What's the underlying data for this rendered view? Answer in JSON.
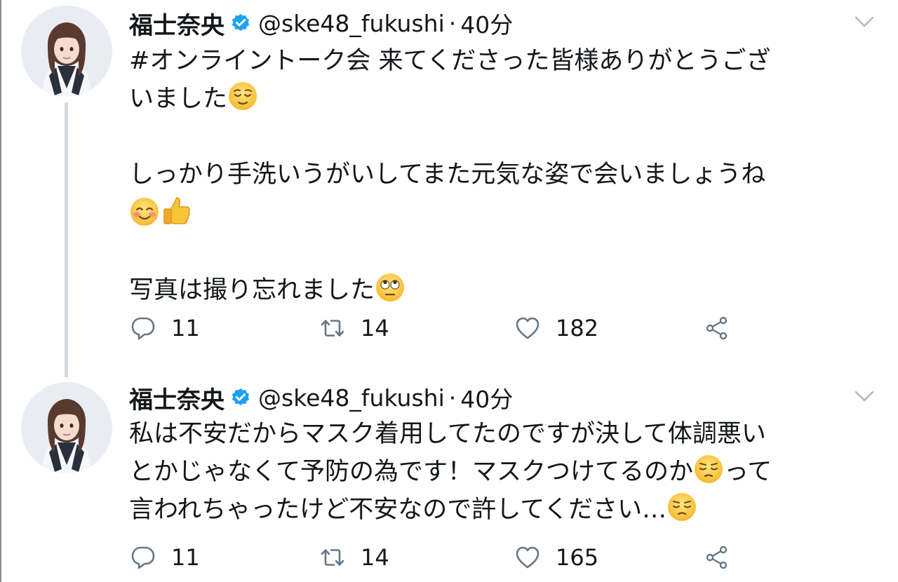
{
  "tweets": [
    {
      "author": {
        "name": "福士奈央",
        "handle": "@ske48_fukushi",
        "verified": true
      },
      "separator": "·",
      "time": "40分",
      "body_lines": [
        "#オンライントーク会 来てくださった皆様ありがとうござ",
        "いました",
        "",
        "しっかり手洗いうがいしてまた元気な姿で会いましょうね",
        "",
        "",
        "写真は撮り忘れました"
      ],
      "emojis": [
        "relieved-face",
        "smiling-face-blush",
        "thumbs-up",
        "face-rolling-eyes"
      ],
      "actions": {
        "replies": "11",
        "retweets": "14",
        "likes": "182"
      }
    },
    {
      "author": {
        "name": "福士奈央",
        "handle": "@ske48_fukushi",
        "verified": true
      },
      "separator": "·",
      "time": "40分",
      "body_lines": [
        "私は不安だからマスク着用してたのですが決して体調悪い",
        "とかじゃなくて予防の為です！マスクつけてるのか",
        "って",
        "言われちゃったけど不安なので許してください…"
      ],
      "emojis": [
        "pensive-face",
        "pensive-face"
      ],
      "actions": {
        "replies": "11",
        "retweets": "14",
        "likes": "165"
      }
    }
  ],
  "colors": {
    "icon_gray": "#657786",
    "thread_line": "#cfd9de",
    "verified_blue": "#1da1f2",
    "text": "#14171a"
  }
}
